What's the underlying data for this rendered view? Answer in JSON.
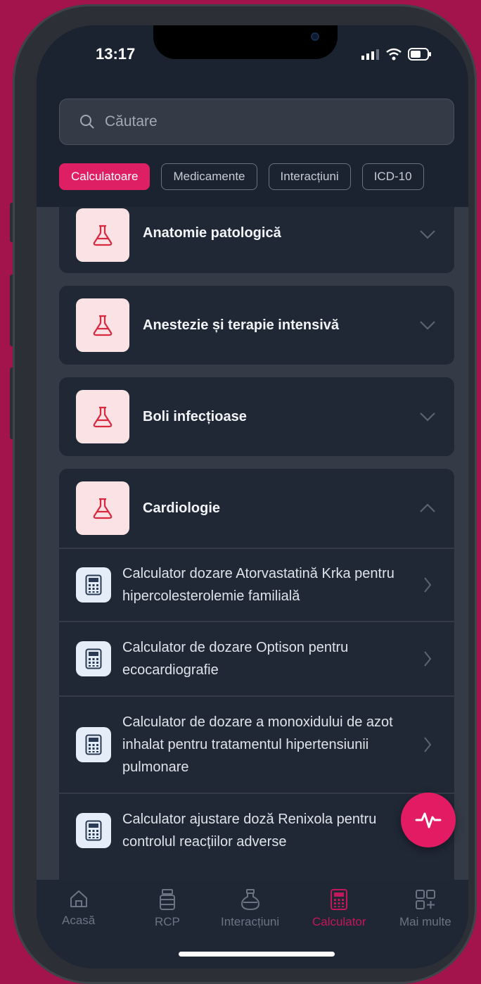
{
  "status_bar": {
    "time": "13:17"
  },
  "search": {
    "placeholder": "Căutare"
  },
  "filters": [
    {
      "label": "Calculatoare",
      "active": true
    },
    {
      "label": "Medicamente",
      "active": false
    },
    {
      "label": "Interacțiuni",
      "active": false
    },
    {
      "label": "ICD-10",
      "active": false
    }
  ],
  "categories": [
    {
      "title": "Anatomie patologică",
      "expanded": false
    },
    {
      "title": "Anestezie și terapie intensivă",
      "expanded": false
    },
    {
      "title": "Boli infecțioase",
      "expanded": false
    },
    {
      "title": "Cardiologie",
      "expanded": true,
      "items": [
        {
          "label": "Calculator dozare Atorvastatină Krka pentru hipercolesterolemie familială"
        },
        {
          "label": "Calculator de dozare Optison pentru ecocardiografie"
        },
        {
          "label": "Calculator de dozare a monoxidului de azot inhalat pentru tratamentul hipertensiunii pulmonare"
        },
        {
          "label": "Calculator ajustare doză Renixola pentru controlul reacțiilor adverse"
        }
      ]
    }
  ],
  "tabbar": [
    {
      "label": "Acasă",
      "icon": "home-icon",
      "active": false
    },
    {
      "label": "RCP",
      "icon": "medicine-bottle-icon",
      "active": false
    },
    {
      "label": "Interacțiuni",
      "icon": "flask-bottle-icon",
      "active": false
    },
    {
      "label": "Calculator",
      "icon": "calculator-icon",
      "active": true
    },
    {
      "label": "Mai multe",
      "icon": "grid-plus-icon",
      "active": false
    }
  ],
  "colors": {
    "accent": "#df1f63",
    "background": "#a3134c",
    "card": "#202836"
  }
}
